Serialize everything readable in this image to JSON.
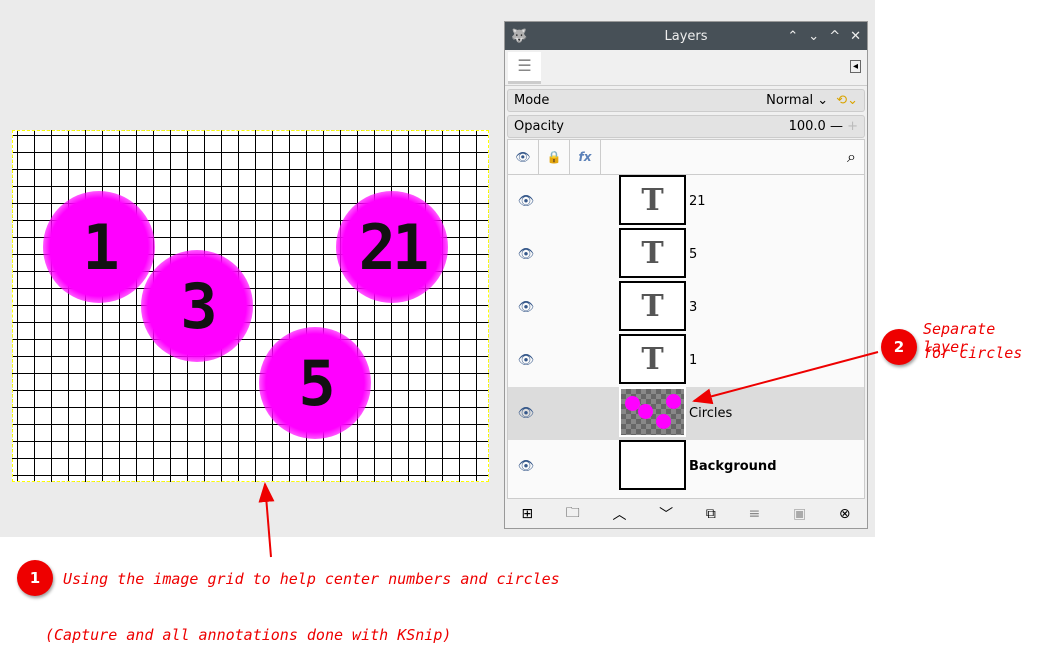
{
  "canvas": {
    "numbers": [
      "1",
      "3",
      "21",
      "5"
    ]
  },
  "panel": {
    "title": "Layers",
    "mode_label": "Mode",
    "mode_value": "Normal",
    "opacity_label": "Opacity",
    "opacity_value": "100.0",
    "layers": [
      {
        "name": "21",
        "type": "text"
      },
      {
        "name": "5",
        "type": "text"
      },
      {
        "name": "3",
        "type": "text"
      },
      {
        "name": "1",
        "type": "text"
      },
      {
        "name": "Circles",
        "type": "image",
        "selected": true
      },
      {
        "name": "Background",
        "type": "fill"
      }
    ]
  },
  "annotations": {
    "badge1": "1",
    "note1": "Using the image grid to help center numbers and circles",
    "badge2": "2",
    "note2_line1": "Separate layer",
    "note2_line2": "for circles",
    "footer": "(Capture and all annotations done with  KSnip)"
  },
  "colors": {
    "accent": "#ff00ff",
    "annotation": "#ee0000"
  }
}
